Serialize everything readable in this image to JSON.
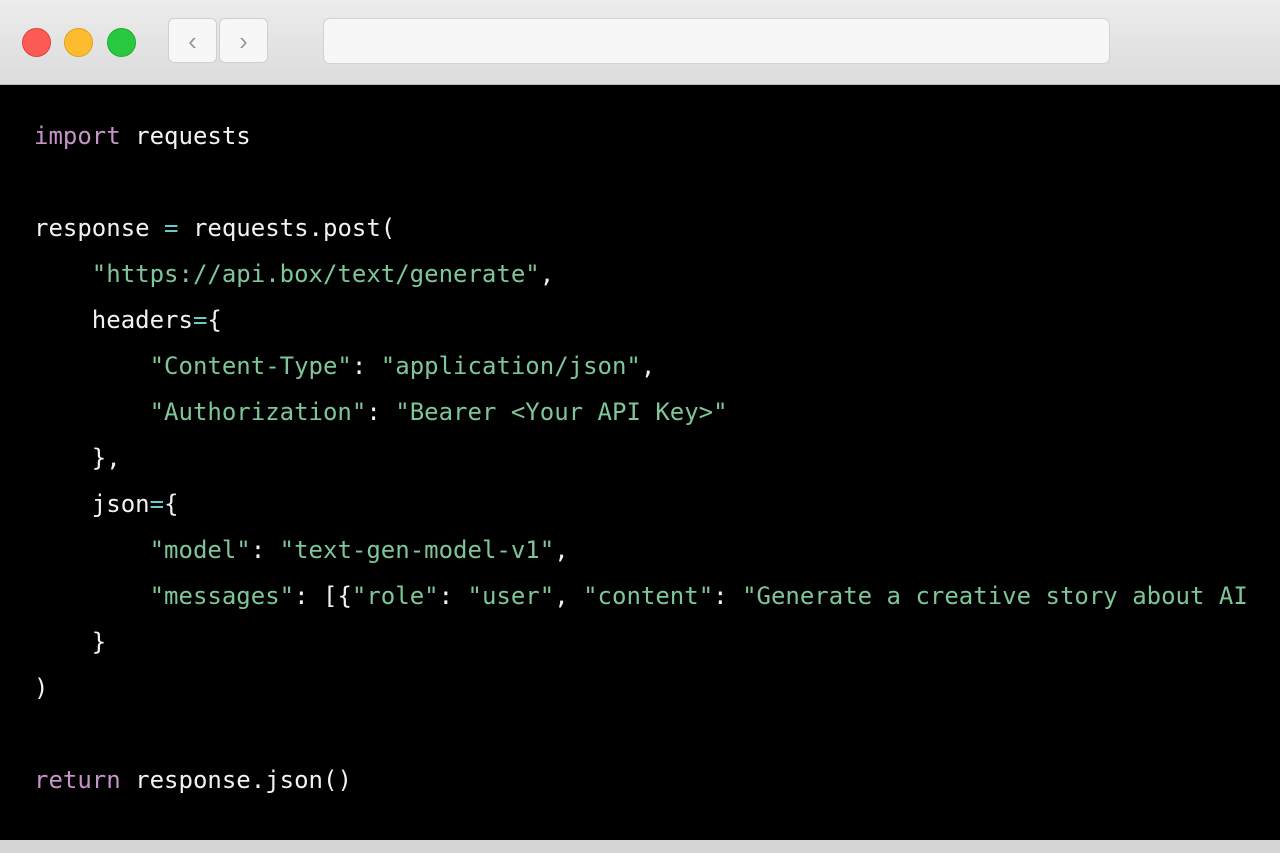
{
  "window": {
    "controls": [
      "close",
      "minimize",
      "zoom"
    ],
    "nav": {
      "back_icon": "chevron-left-icon",
      "forward_icon": "chevron-right-icon"
    },
    "address_bar": {
      "value": ""
    }
  },
  "colors": {
    "keyword": "#c593c8",
    "string": "#7ec699",
    "operator": "#67cdcc",
    "text": "#f2f2f2",
    "background": "#000000"
  },
  "code": {
    "lines": [
      [
        [
          "kw",
          "import"
        ],
        [
          "id",
          " requests"
        ]
      ],
      [],
      [
        [
          "id",
          "response "
        ],
        [
          "op",
          "="
        ],
        [
          "id",
          " requests.post("
        ]
      ],
      [
        [
          "id",
          "    "
        ],
        [
          "str",
          "\"https://api.box/text/generate\""
        ],
        [
          "pn",
          ","
        ]
      ],
      [
        [
          "id",
          "    headers"
        ],
        [
          "op",
          "="
        ],
        [
          "pn",
          "{"
        ]
      ],
      [
        [
          "id",
          "        "
        ],
        [
          "str",
          "\"Content-Type\""
        ],
        [
          "pn",
          ": "
        ],
        [
          "str",
          "\"application/json\""
        ],
        [
          "pn",
          ","
        ]
      ],
      [
        [
          "id",
          "        "
        ],
        [
          "str",
          "\"Authorization\""
        ],
        [
          "pn",
          ": "
        ],
        [
          "str",
          "\"Bearer <Your API Key>\""
        ]
      ],
      [
        [
          "pn",
          "    },"
        ]
      ],
      [
        [
          "id",
          "    json"
        ],
        [
          "op",
          "="
        ],
        [
          "pn",
          "{"
        ]
      ],
      [
        [
          "id",
          "        "
        ],
        [
          "str",
          "\"model\""
        ],
        [
          "pn",
          ": "
        ],
        [
          "str",
          "\"text-gen-model-v1\""
        ],
        [
          "pn",
          ","
        ]
      ],
      [
        [
          "id",
          "        "
        ],
        [
          "str",
          "\"messages\""
        ],
        [
          "pn",
          ": [{"
        ],
        [
          "str",
          "\"role\""
        ],
        [
          "pn",
          ": "
        ],
        [
          "str",
          "\"user\""
        ],
        [
          "pn",
          ", "
        ],
        [
          "str",
          "\"content\""
        ],
        [
          "pn",
          ": "
        ],
        [
          "str",
          "\"Generate a creative story about AI"
        ]
      ],
      [
        [
          "pn",
          "    }"
        ]
      ],
      [
        [
          "pn",
          ")"
        ]
      ],
      [],
      [
        [
          "kw",
          "return"
        ],
        [
          "id",
          " response.json()"
        ]
      ]
    ]
  }
}
